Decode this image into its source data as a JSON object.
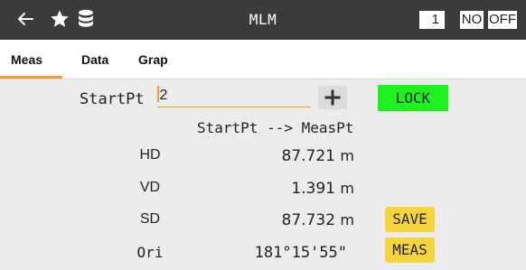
{
  "titlebar": {
    "title": "MLM",
    "icons": [
      "back-arrow-icon",
      "star-icon",
      "database-icon"
    ],
    "count": "1",
    "no_label": "NO",
    "off_label": "OFF"
  },
  "tabs": [
    {
      "label": "Meas",
      "active": true
    },
    {
      "label": "Data",
      "active": false
    },
    {
      "label": "Grap",
      "active": false
    }
  ],
  "form": {
    "start_label": "StartPt",
    "start_value": "2",
    "plus_icon": "plus-icon",
    "lock_label": "LOCK"
  },
  "results": {
    "header": "StartPt --> MeasPt",
    "rows": [
      {
        "label": "HD",
        "value": "87.721",
        "unit": "m"
      },
      {
        "label": "VD",
        "value": "1.391",
        "unit": "m"
      },
      {
        "label": "SD",
        "value": "87.732",
        "unit": "m"
      },
      {
        "label": "Ori",
        "value": "181°15'55\"",
        "unit": ""
      }
    ]
  },
  "buttons": {
    "save_label": "SAVE",
    "meas_label": "MEAS"
  },
  "colors": {
    "titlebar_bg": "#3b3b3b",
    "accent_orange": "#f29c2f",
    "lock_green": "#1ef21e",
    "button_yellow": "#f6d43b",
    "content_bg": "#ececec"
  }
}
